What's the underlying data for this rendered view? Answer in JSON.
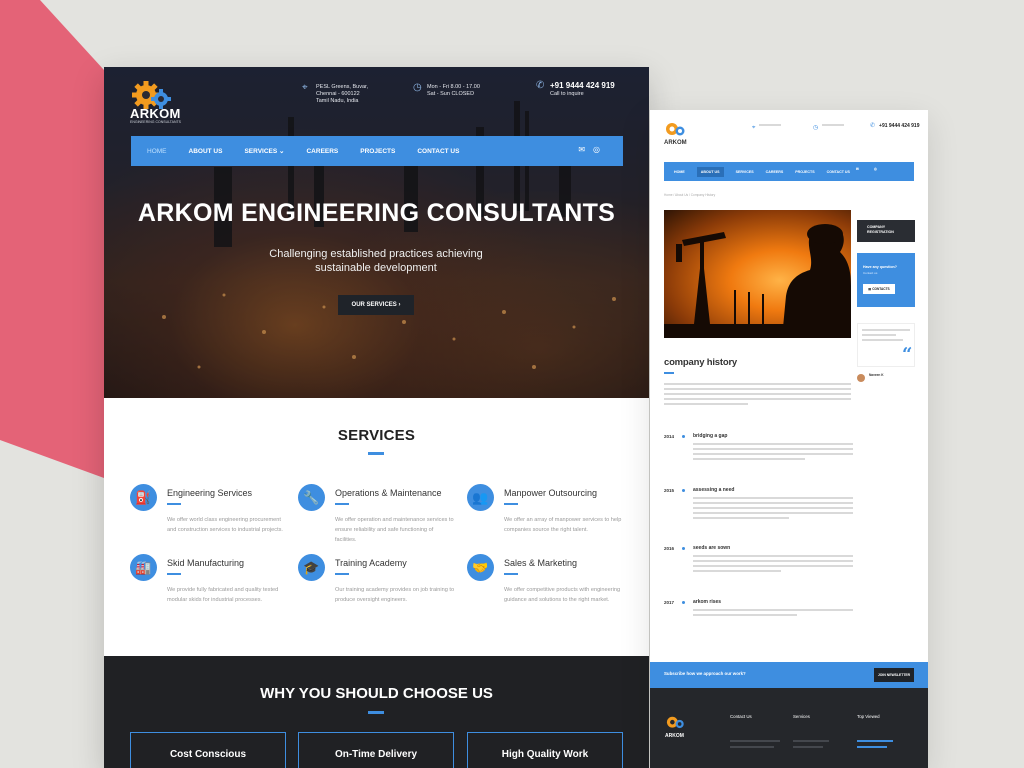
{
  "left_site": {
    "brand": {
      "name": "ARKOM",
      "tagline": "ENGINEERING CONSULTANTS"
    },
    "header": {
      "address": "PESL Greens, Buvar,\nChennai - 600122\nTamil Nadu, India",
      "hours": "Mon - Fri 8.00 - 17.00\nSat - Sun CLOSED",
      "phone": "+91 9444 424 919",
      "phone_sub": "Call to inquire"
    },
    "nav": {
      "items": [
        "HOME",
        "ABOUT US",
        "SERVICES",
        "CAREERS",
        "PROJECTS",
        "CONTACT US"
      ],
      "active": "HOME"
    },
    "hero": {
      "title": "ARKOM ENGINEERING CONSULTANTS",
      "subtitle": "Challenging established practices achieving sustainable development",
      "button": "OUR SERVICES"
    },
    "services": {
      "title": "SERVICES",
      "items": [
        {
          "name": "Engineering Services",
          "icon": "oil-pump-icon",
          "desc": "We offer world class engineering procurement and construction services to industrial projects."
        },
        {
          "name": "Operations & Maintenance",
          "icon": "wrench-icon",
          "desc": "We offer operation and maintenance services to ensure reliability and safe functioning of facilities."
        },
        {
          "name": "Manpower Outsourcing",
          "icon": "people-icon",
          "desc": "We offer an array of manpower services to help companies source the right talent."
        },
        {
          "name": "Skid Manufacturing",
          "icon": "factory-icon",
          "desc": "We provide fully fabricated and quality tested modular skids for industrial processes."
        },
        {
          "name": "Training Academy",
          "icon": "graduation-cap-icon",
          "desc": "Our training academy provides on job training to produce oversight engineers."
        },
        {
          "name": "Sales & Marketing",
          "icon": "handshake-icon",
          "desc": "We offer competitive products with engineering guidance and solutions to the right market."
        }
      ]
    },
    "why": {
      "title": "WHY YOU SHOULD CHOOSE US",
      "cards": [
        "Cost Conscious",
        "On-Time Delivery",
        "High Quality Work"
      ]
    }
  },
  "right_site": {
    "brand": "ARKOM",
    "phone": "+91 9444 424 919",
    "nav": [
      "HOME",
      "ABOUT US",
      "SERVICES",
      "CAREERS",
      "PROJECTS",
      "CONTACT US"
    ],
    "breadcrumb": "Home  /  About Us  /  Company History",
    "sidebar": {
      "dark_box": "COMPANY\nREGISTRATION",
      "question": "Have any question?",
      "question_sub": "Contact us",
      "button": "CONTACTS",
      "author": "Naveen K"
    },
    "heading": "company history",
    "timeline": [
      {
        "year": "2014",
        "title": "bridging a gap"
      },
      {
        "year": "2015",
        "title": "assessing a need"
      },
      {
        "year": "2016",
        "title": "seeds are sown"
      },
      {
        "year": "2017",
        "title": "arkom rises"
      }
    ],
    "subscribe": {
      "text": "Subscribe how we approach our work?",
      "button": "JOIN NEWSLETTER"
    },
    "footer": {
      "columns": [
        "Contact Us",
        "Services",
        "Top Viewed"
      ]
    }
  },
  "colors": {
    "accent": "#3e8ee0",
    "dark": "#202124",
    "background": "#e3e3df",
    "decor": "#e46377"
  }
}
